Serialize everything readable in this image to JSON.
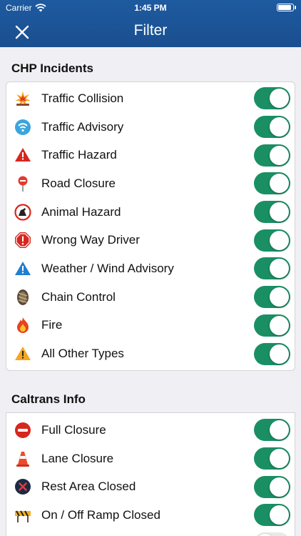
{
  "status": {
    "carrier": "Carrier",
    "time": "1:45 PM",
    "battery_level": 0.95
  },
  "nav": {
    "title": "Filter",
    "close_icon": "close-icon"
  },
  "colors": {
    "header": "#1a4f8f",
    "toggle_on": "#1a8f64"
  },
  "sections": [
    {
      "title": "CHP Incidents",
      "items": [
        {
          "label": "Traffic Collision",
          "icon": "collision-icon",
          "on": true
        },
        {
          "label": "Traffic Advisory",
          "icon": "advisory-wifi-icon",
          "on": true
        },
        {
          "label": "Traffic Hazard",
          "icon": "hazard-triangle-icon",
          "on": true
        },
        {
          "label": "Road Closure",
          "icon": "road-closure-sign-icon",
          "on": true
        },
        {
          "label": "Animal Hazard",
          "icon": "animal-hazard-icon",
          "on": true
        },
        {
          "label": "Wrong Way Driver",
          "icon": "wrong-way-icon",
          "on": true
        },
        {
          "label": "Weather / Wind Advisory",
          "icon": "weather-warning-icon",
          "on": true
        },
        {
          "label": "Chain Control",
          "icon": "tire-chain-icon",
          "on": true
        },
        {
          "label": "Fire",
          "icon": "fire-icon",
          "on": true
        },
        {
          "label": "All Other Types",
          "icon": "warning-triangle-icon",
          "on": true
        }
      ]
    },
    {
      "title": "Caltrans Info",
      "items": [
        {
          "label": "Full Closure",
          "icon": "no-entry-icon",
          "on": true
        },
        {
          "label": "Lane Closure",
          "icon": "traffic-cone-icon",
          "on": true
        },
        {
          "label": "Rest Area Closed",
          "icon": "rest-area-closed-icon",
          "on": true
        },
        {
          "label": "On / Off Ramp Closed",
          "icon": "ramp-barricade-icon",
          "on": true
        }
      ]
    }
  ]
}
